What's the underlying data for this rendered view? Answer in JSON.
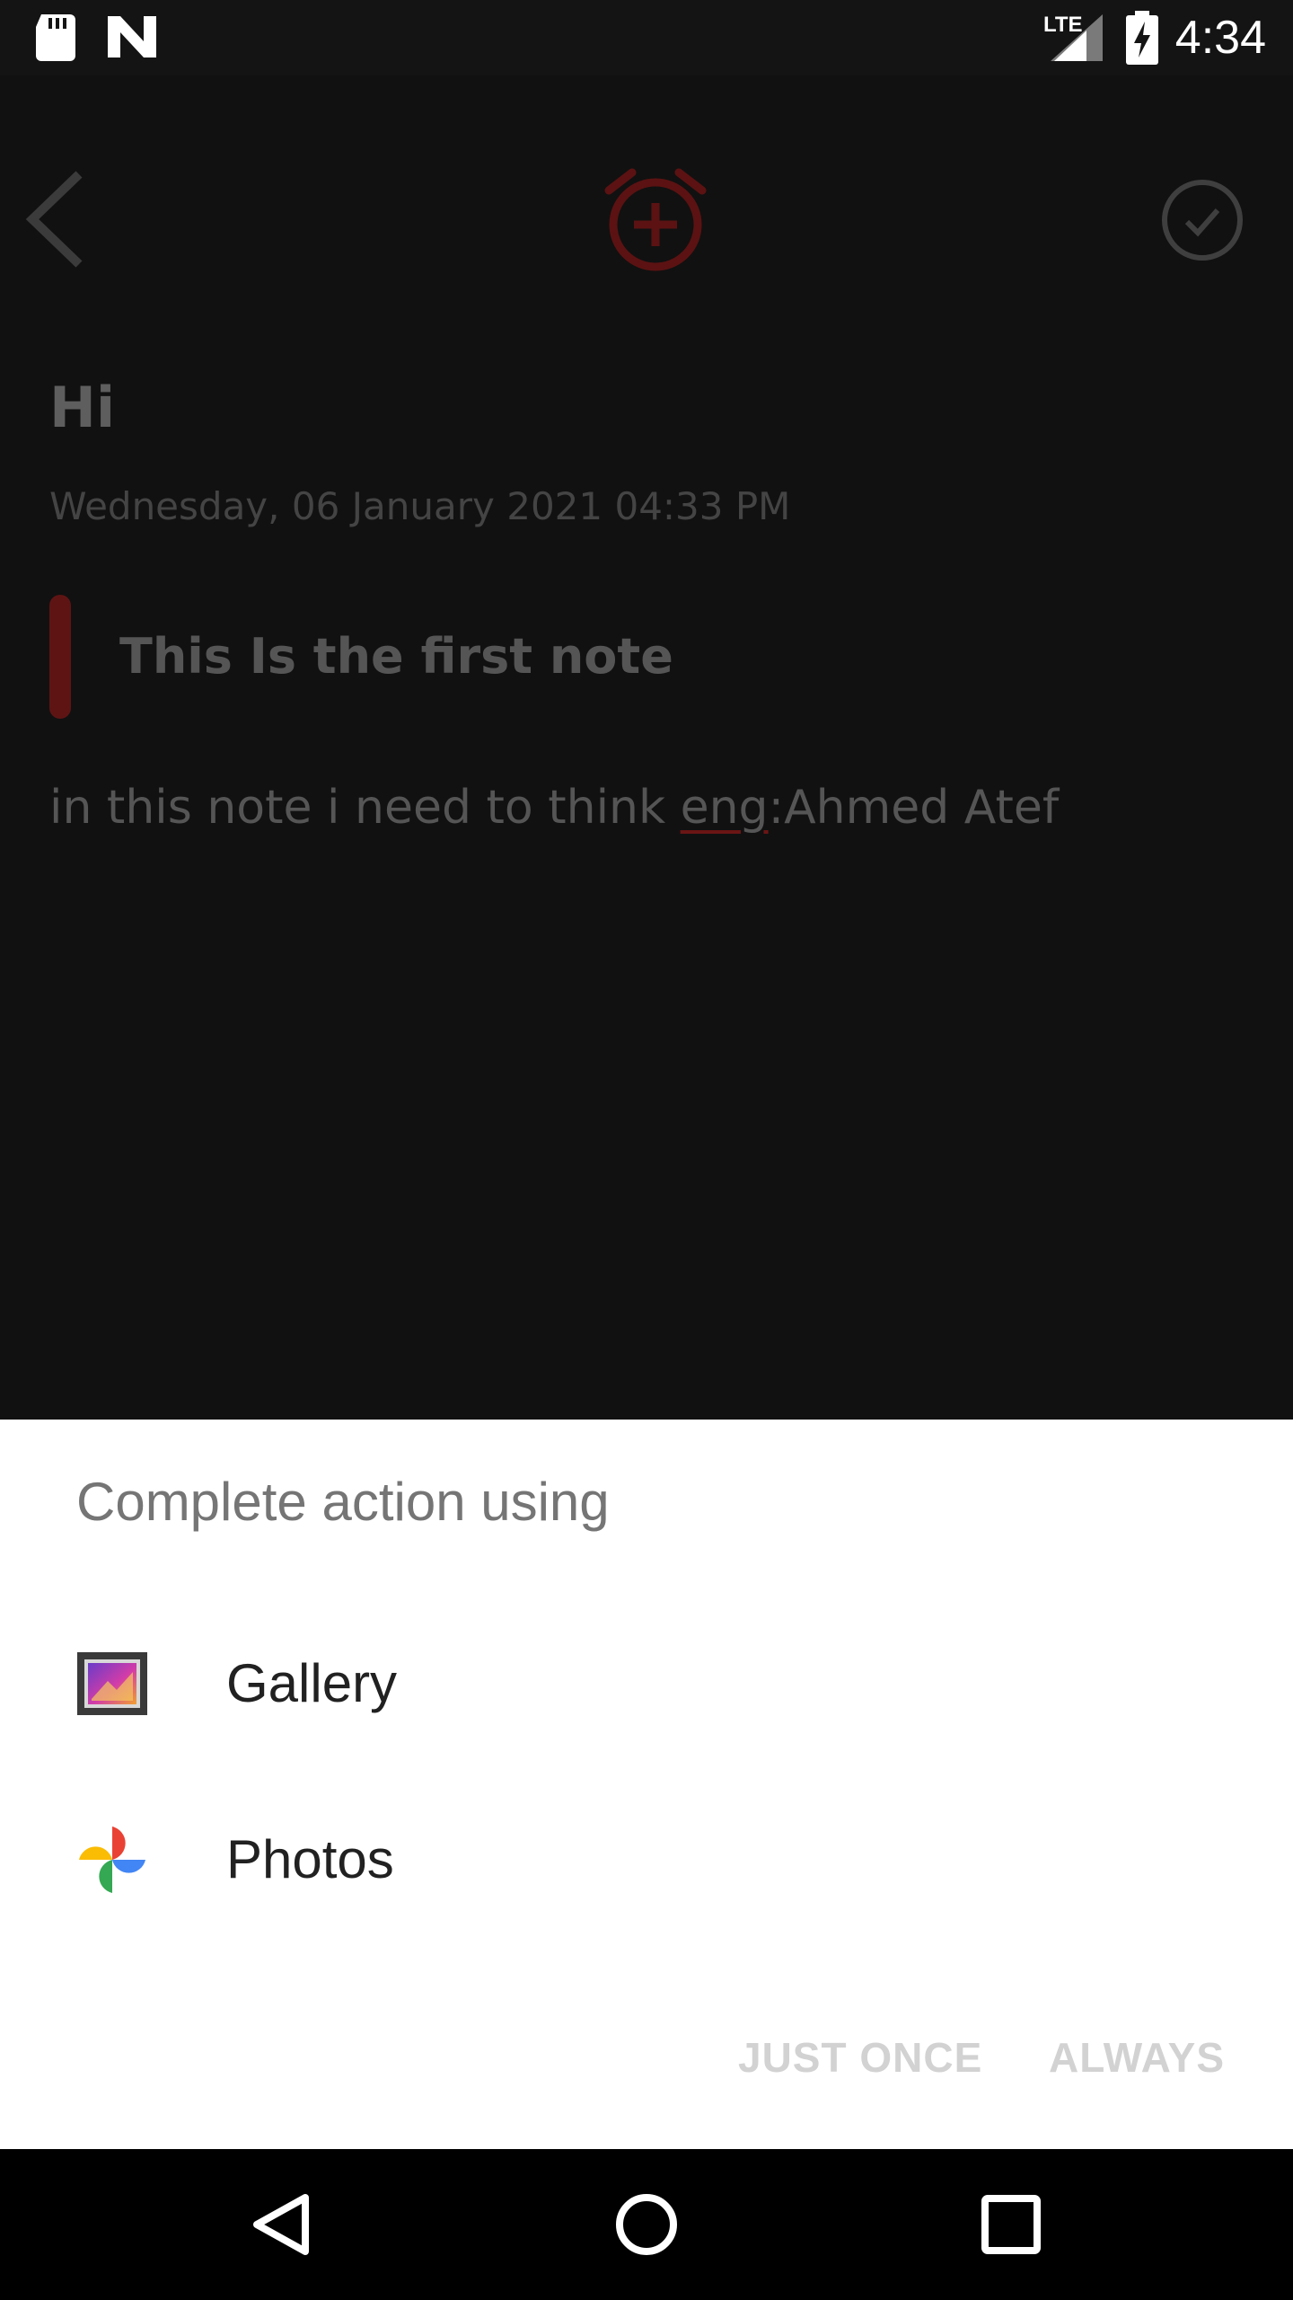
{
  "status_bar": {
    "time": "4:34",
    "network_label": "LTE"
  },
  "note": {
    "title": "Hi",
    "date": "Wednesday, 06 January 2021 04:33 PM",
    "subtitle": "This Is the first note",
    "body_prefix": "in this note i need to think ",
    "body_misspelled": "eng",
    "body_suffix": ":Ahmed Atef"
  },
  "chooser": {
    "title": "Complete action using",
    "apps": [
      {
        "label": "Gallery",
        "icon": "gallery-icon"
      },
      {
        "label": "Photos",
        "icon": "photos-icon"
      }
    ],
    "just_once_label": "JUST ONCE",
    "always_label": "ALWAYS"
  },
  "colors": {
    "accent_red": "#6b1414",
    "sheet_background": "#ffffff",
    "disabled_button_text": "#d2d2d2"
  }
}
